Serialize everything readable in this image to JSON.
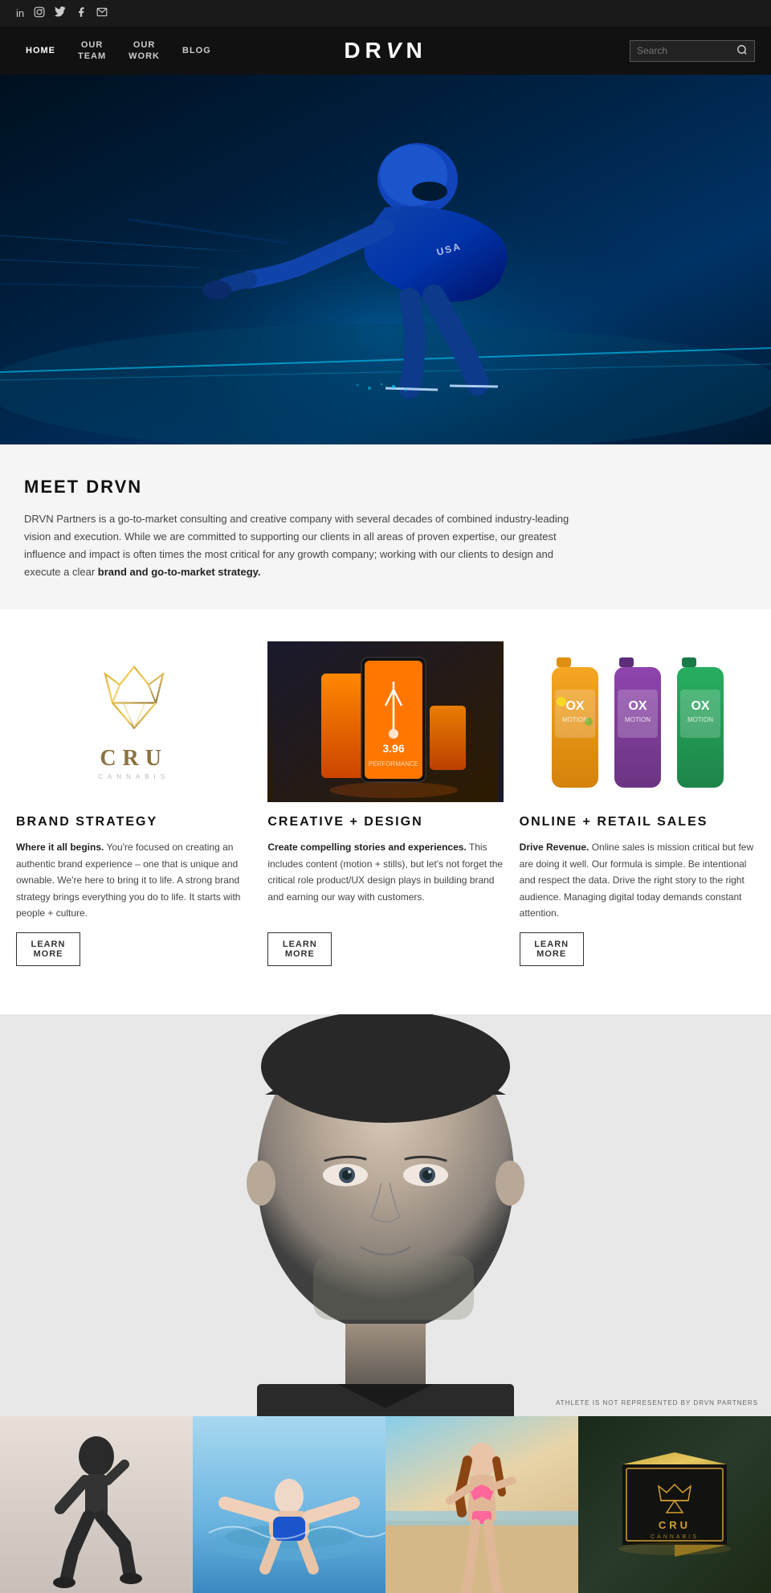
{
  "social": {
    "icons": [
      "in",
      "○",
      "t",
      "f",
      "✉"
    ]
  },
  "nav": {
    "home": "HOME",
    "our_team": "OUR\nTEAM",
    "our_work": "OUR\nWORK",
    "blog": "BLOG",
    "logo": "DRVN",
    "search_placeholder": "Search"
  },
  "meet": {
    "title": "MEET DRVN",
    "body": "DRVN Partners is a go-to-market consulting and creative company with several decades of combined industry-leading vision and execution. While we are committed to supporting our clients in all areas of proven expertise, our greatest influence and impact is often times the most critical for any growth company; working with our clients to design and execute a clear ",
    "bold": "brand and go-to-market strategy."
  },
  "services": [
    {
      "title": "BRAND STRATEGY",
      "intro_bold": "Where it all begins.",
      "intro_rest": " You're focused on creating an authentic brand experience – one that is unique and ownable. We're here to bring it to life. A strong brand strategy brings everything you do to life. It starts with people + culture.",
      "btn": "LEARN\nMORE"
    },
    {
      "title": "CREATIVE + DESIGN",
      "intro_bold": "Create compelling stories and experiences.",
      "intro_rest": " This includes content (motion + stills), but let's not forget the critical role product/UX design plays in building brand and earning our way with customers.",
      "btn": "LEARN\nMORE"
    },
    {
      "title": "ONLINE + RETAIL SALES",
      "intro_bold": "Drive Revenue.",
      "intro_rest": " Online sales is mission critical but few are doing it well. Our formula is simple. Be intentional and respect the data. Drive the right story to the right audience. Managing digital today demands constant attention.",
      "btn": "LEARN\nMORE"
    }
  ],
  "athlete": {
    "disclaimer": "ATHLETE IS NOT REPRESENTED BY DRVN PARTNERS"
  },
  "portfolio": {
    "items": [
      "runner",
      "swimmer",
      "bikini",
      "cru-product"
    ]
  },
  "cru_logo": {
    "name": "CRU",
    "sub": "CANNABIS"
  },
  "ox_drinks": {
    "colors": [
      "#f5a623",
      "#7b4f9e",
      "#2ecc71"
    ],
    "label": "OX"
  }
}
